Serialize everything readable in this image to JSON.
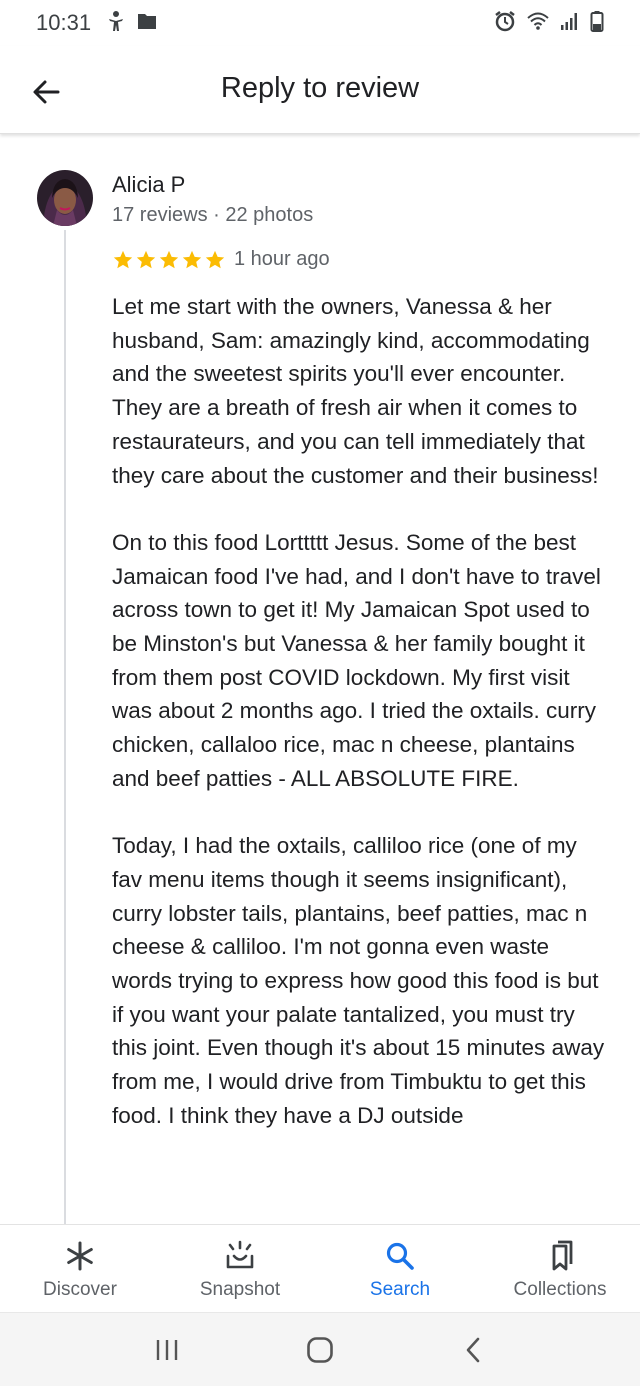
{
  "status_bar": {
    "time": "10:31"
  },
  "app_bar": {
    "title": "Reply to review",
    "back_icon": "arrow-back-icon"
  },
  "review": {
    "reviewer_name": "Alicia P",
    "reviewer_meta": "17 reviews · 22 photos",
    "rating": 5,
    "max_rating": 5,
    "time_ago": "1 hour ago",
    "paragraphs": [
      "Let me start with the owners, Vanessa & her husband, Sam: amazingly kind, accommodating and the sweetest spirits you'll ever encounter. They are a breath of fresh air when it comes to restaurateurs, and you can tell immediately that they care about the customer and their business!",
      "On to this food Lorttttt Jesus. Some of the best Jamaican food I've had, and I don't have to travel across town to get it! My Jamaican Spot used to be Minston's but Vanessa & her family bought it from them post COVID lockdown. My first visit was about 2 months ago. I tried the oxtails. curry chicken, callaloo rice, mac n cheese, plantains and beef patties - ALL ABSOLUTE FIRE.",
      "Today, I had the oxtails, calliloo rice (one of my fav menu items though it seems insignificant), curry lobster tails, plantains, beef patties, mac n cheese & calliloo. I'm not gonna even waste words trying to express how good this food is but if you want your palate tantalized, you must try this joint. Even though it's about 15 minutes away from me, I would drive from Timbuktu to get this food. I think they have a DJ outside"
    ]
  },
  "bottom_nav": {
    "items": [
      {
        "label": "Discover",
        "icon": "asterisk-icon",
        "active": false
      },
      {
        "label": "Snapshot",
        "icon": "snapshot-icon",
        "active": false
      },
      {
        "label": "Search",
        "icon": "search-icon",
        "active": true
      },
      {
        "label": "Collections",
        "icon": "bookmarks-icon",
        "active": false
      }
    ]
  },
  "colors": {
    "accent": "#1a73e8",
    "star": "#fbbc04",
    "text_primary": "#202124",
    "text_secondary": "#5f6368"
  }
}
